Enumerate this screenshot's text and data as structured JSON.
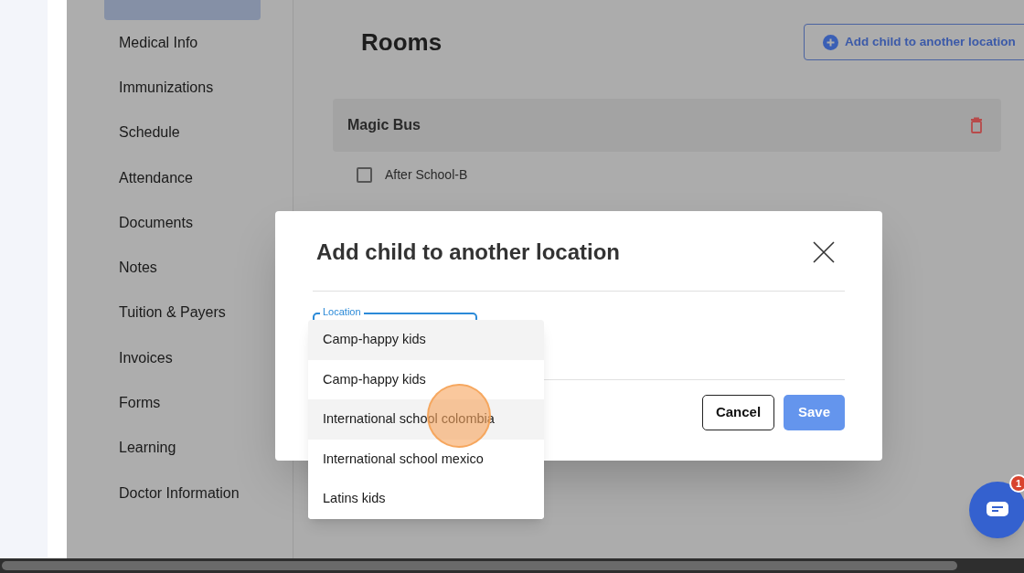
{
  "sidebar": {
    "items": [
      {
        "selected": true
      },
      {
        "label": "Medical Info",
        "selected": false
      },
      {
        "label": "Immunizations",
        "selected": false
      },
      {
        "label": "Schedule",
        "selected": false
      },
      {
        "label": "Attendance",
        "selected": false
      },
      {
        "label": "Documents",
        "selected": false
      },
      {
        "label": "Notes",
        "selected": false
      },
      {
        "label": "Tuition & Payers",
        "selected": false
      },
      {
        "label": "Invoices",
        "selected": false
      },
      {
        "label": "Forms",
        "selected": false
      },
      {
        "label": "Learning",
        "selected": false
      },
      {
        "label": "Doctor Information",
        "selected": false
      }
    ]
  },
  "main": {
    "title": "Rooms",
    "add_button": "Add child to another location",
    "location_card": {
      "name": "Magic Bus",
      "rooms": [
        {
          "label": "After School-B",
          "checked": false
        }
      ]
    }
  },
  "modal": {
    "title": "Add child to another location",
    "field_label": "Location",
    "options": [
      {
        "label": "Camp-happy kids",
        "highlighted": true
      },
      {
        "label": "Camp-happy kids",
        "highlighted": false
      },
      {
        "label": "International school colombia",
        "highlighted": true
      },
      {
        "label": "International school mexico",
        "highlighted": false
      },
      {
        "label": "Latins kids",
        "highlighted": false
      }
    ],
    "buttons": [
      {
        "label": "Cancel",
        "kind": "secondary"
      },
      {
        "label": "Save",
        "kind": "primary"
      }
    ]
  },
  "chat": {
    "badge": "1"
  }
}
